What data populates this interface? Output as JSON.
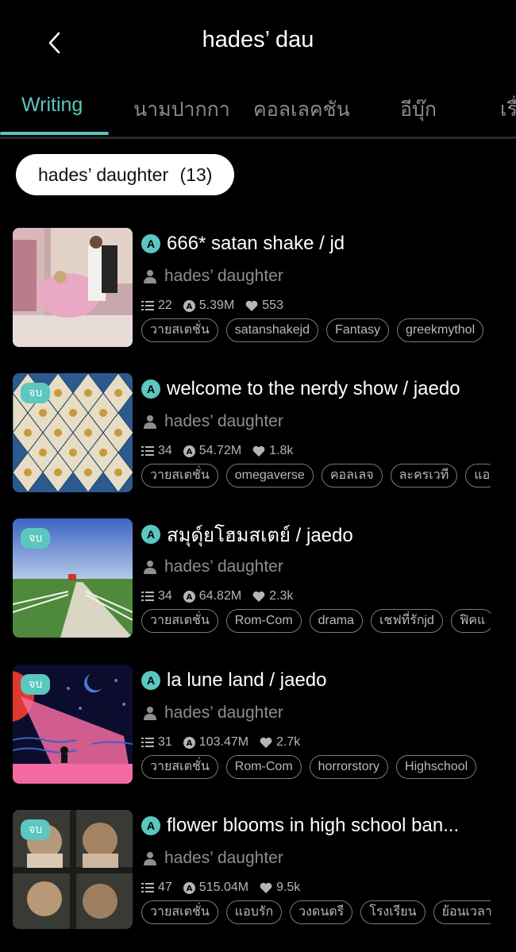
{
  "header": {
    "title": "hades’ dau"
  },
  "tabs": [
    {
      "label": "Writing"
    },
    {
      "label": "นามปากกา"
    },
    {
      "label": "คอลเลคชัน"
    },
    {
      "label": "อีบุ๊ก"
    },
    {
      "label": "เรื่"
    }
  ],
  "filter": {
    "label": "hades’ daughter",
    "count": "(13)"
  },
  "stories": [
    {
      "title": "666* satan shake / jd",
      "author": "hades’ daughter",
      "chapters": "22",
      "views": "5.39M",
      "likes": "553",
      "end_badge": "",
      "tags": [
        "วายสเตชั่น",
        "satanshakejd",
        "Fantasy",
        "greekmythol"
      ]
    },
    {
      "title": "welcome to the nerdy show / jaedo",
      "author": "hades’ daughter",
      "chapters": "34",
      "views": "54.72M",
      "likes": "1.8k",
      "end_badge": "จบ",
      "tags": [
        "วายสเตชั่น",
        "omegaverse",
        "คอลเลจ",
        "ละครเวที",
        "แอ"
      ]
    },
    {
      "title": "สมุดุ์ยโฮมสเตย์ / jaedo",
      "author": "hades’ daughter",
      "chapters": "34",
      "views": "64.82M",
      "likes": "2.3k",
      "end_badge": "จบ",
      "tags": [
        "วายสเตชั่น",
        "Rom-Com",
        "drama",
        "เชฟที่รักjd",
        "ฟิคแ"
      ]
    },
    {
      "title": "la lune land / jaedo",
      "author": "hades’ daughter",
      "chapters": "31",
      "views": "103.47M",
      "likes": "2.7k",
      "end_badge": "จบ",
      "tags": [
        "วายสเตชั่น",
        "Rom-Com",
        "horrorstory",
        "Highschool"
      ]
    },
    {
      "title": "flower blooms in high school ban...",
      "author": "hades’ daughter",
      "chapters": "47",
      "views": "515.04M",
      "likes": "9.5k",
      "end_badge": "จบ",
      "tags": [
        "วายสเตชั่น",
        "แอบรัก",
        "วงดนตรี",
        "โรงเรียน",
        "ย้อนเวลา"
      ]
    }
  ],
  "colors": {
    "accent": "#5cc6c0",
    "background": "#000000",
    "muted_text": "#8e8e8e"
  }
}
